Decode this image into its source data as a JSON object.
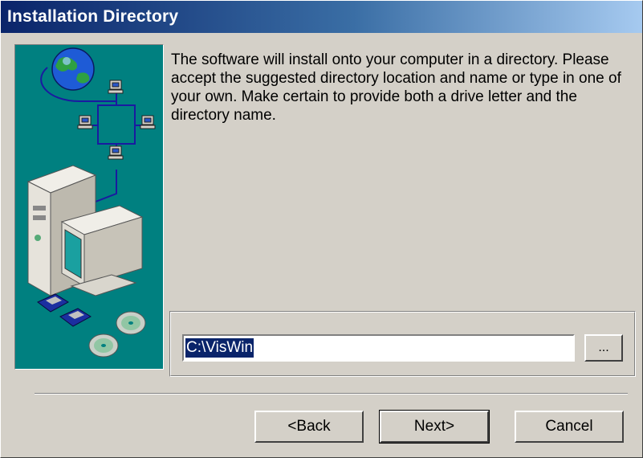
{
  "dialog": {
    "title": "Installation Directory",
    "description": "The software will install onto your computer in a directory.  Please accept the suggested directory location and name or type in one of your own.  Make certain to provide both a drive letter and the directory name.",
    "directory_value": "C:\\VisWin",
    "browse_label": "...",
    "buttons": {
      "back": "<Back",
      "next": "Next>",
      "cancel": "Cancel"
    }
  },
  "colors": {
    "title_start": "#0a246a",
    "title_end": "#a6caf0",
    "art_background": "#008080",
    "dialog_face": "#d4d0c8"
  }
}
